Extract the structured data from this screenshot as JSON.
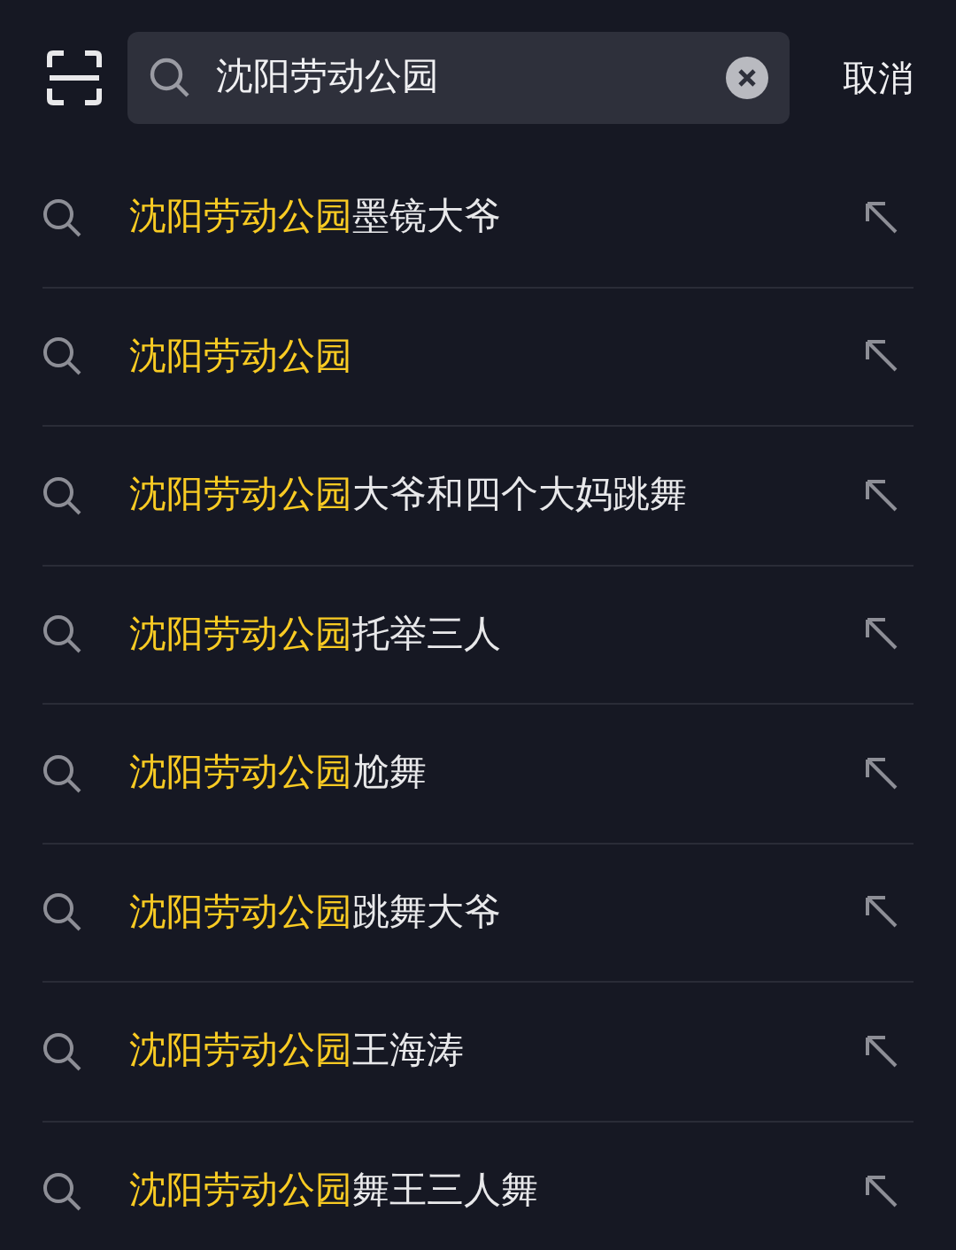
{
  "search": {
    "value": "沈阳劳动公园",
    "cancel": "取消"
  },
  "suggestions": [
    {
      "match": "沈阳劳动公园",
      "rest": "墨镜大爷"
    },
    {
      "match": "沈阳劳动公园"
    },
    {
      "match": "沈阳劳动公园",
      "rest": "大爷和四个大妈跳舞"
    },
    {
      "match": "沈阳劳动公园",
      "rest": "托举三人"
    },
    {
      "match": "沈阳劳动公园",
      "rest": "尬舞"
    },
    {
      "match": "沈阳劳动公园",
      "rest": "跳舞大爷"
    },
    {
      "match": "沈阳劳动公园",
      "rest": "王海涛"
    },
    {
      "match": "沈阳劳动公园",
      "rest": "舞王三人舞"
    }
  ]
}
